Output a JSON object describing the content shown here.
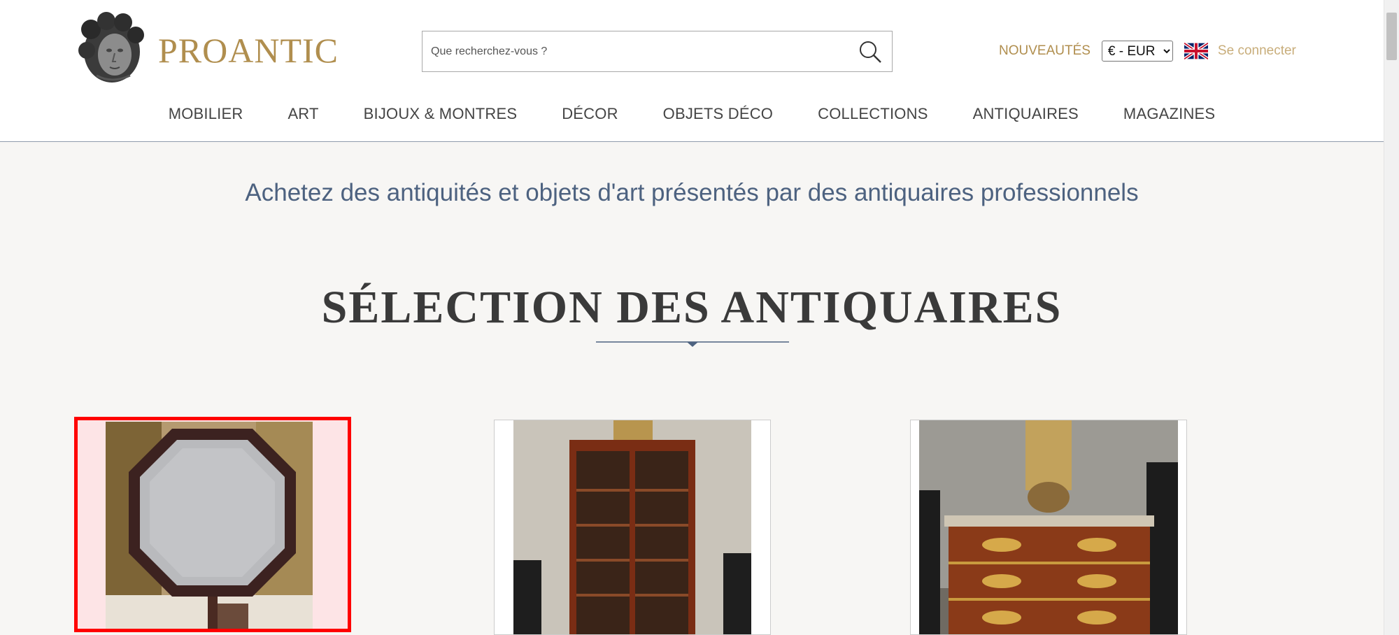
{
  "header": {
    "logo_text": "PROANTIC",
    "search": {
      "placeholder": "Que recherchez-vous ?",
      "value": ""
    },
    "nouveautes_label": "NOUVEAUTÉS",
    "currency": {
      "selected": "€ - EUR",
      "options": [
        "€ - EUR"
      ]
    },
    "language_flag": "uk-flag-icon",
    "login_label": "Se connecter"
  },
  "menu": {
    "items": [
      {
        "label": "MOBILIER"
      },
      {
        "label": "ART"
      },
      {
        "label": "BIJOUX & MONTRES"
      },
      {
        "label": "DÉCOR"
      },
      {
        "label": "OBJETS DÉCO"
      },
      {
        "label": "COLLECTIONS"
      },
      {
        "label": "ANTIQUAIRES"
      },
      {
        "label": "MAGAZINES"
      }
    ]
  },
  "main": {
    "tagline": "Achetez des antiquités et objets d'art présentés par des antiquaires professionnels",
    "section_title": "SÉLECTION DES ANTIQUAIRES",
    "cards": [
      {
        "image": "octagonal-tilt-top-table-image",
        "selected": true
      },
      {
        "image": "mahogany-glazed-bookcase-image",
        "selected": false
      },
      {
        "image": "louis-xv-commode-image",
        "selected": false
      }
    ]
  },
  "colors": {
    "brand_gold": "#b08e4e",
    "tagline_blue": "#4d6280",
    "selection_red": "#ff0000"
  }
}
